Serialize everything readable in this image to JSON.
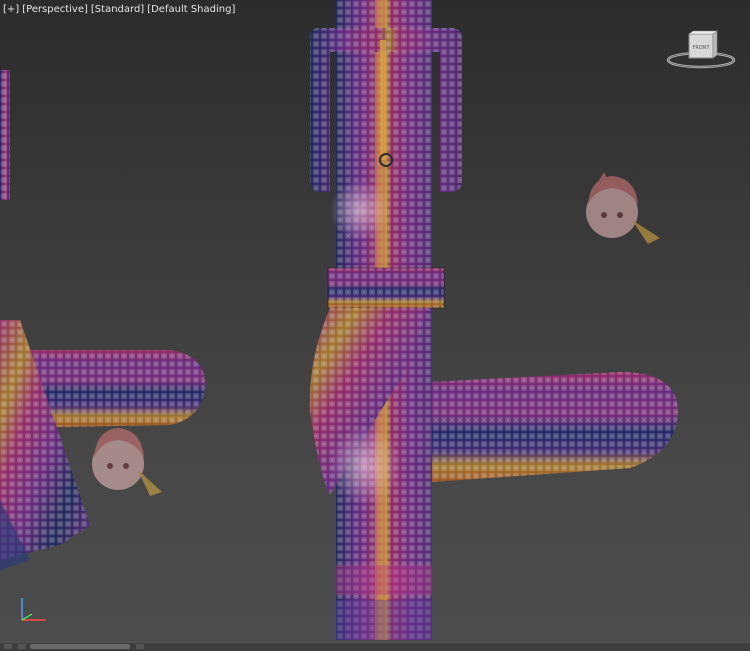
{
  "viewport": {
    "labels": {
      "plus": "[+]",
      "view": "[Perspective]",
      "preset": "[Standard]",
      "shading": "[Default Shading]"
    },
    "viewcube": {
      "face": "FRONT"
    }
  },
  "colors": {
    "background_top": "#2c2c2c",
    "background_bottom": "#4c4c4c",
    "stripe_pink": "#d23a7a",
    "stripe_purple": "#8a3aa8",
    "stripe_violet": "#5a3a9a",
    "stripe_blue": "#2e3a7a",
    "stripe_yellow": "#d8b040",
    "stripe_orange": "#d07030"
  }
}
